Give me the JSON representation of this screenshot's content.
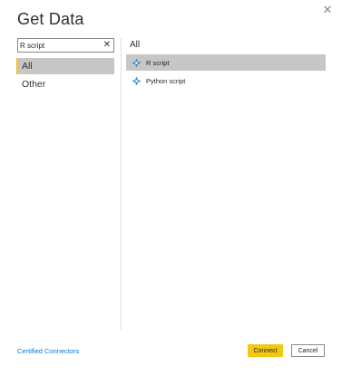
{
  "dialog": {
    "title": "Get Data",
    "close_icon": "close-icon"
  },
  "search": {
    "value": "R script",
    "clear_icon": "clear-icon"
  },
  "categories": [
    {
      "label": "All",
      "selected": true
    },
    {
      "label": "Other",
      "selected": false
    }
  ],
  "section": {
    "header": "All"
  },
  "sources": [
    {
      "label": "R script",
      "icon": "r-script-icon",
      "selected": true
    },
    {
      "label": "Python script",
      "icon": "python-script-icon",
      "selected": false
    }
  ],
  "footer": {
    "certified_link": "Certified Connectors",
    "connect_label": "Connect",
    "cancel_label": "Cancel"
  },
  "colors": {
    "accent": "#f2c811",
    "selection": "#c8c6c4",
    "link": "#0078d4",
    "icon_blue": "#2e8ad8"
  }
}
